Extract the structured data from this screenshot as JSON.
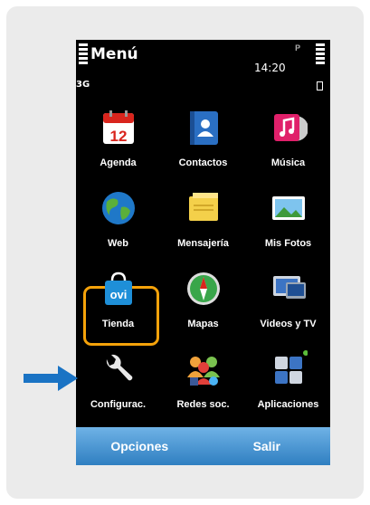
{
  "status": {
    "title": "Menú",
    "network": "3G",
    "time": "14:20"
  },
  "apps": [
    {
      "label": "Agenda",
      "icon": "calendar-icon",
      "badge": "12"
    },
    {
      "label": "Contactos",
      "icon": "contacts-icon"
    },
    {
      "label": "Música",
      "icon": "music-icon"
    },
    {
      "label": "Web",
      "icon": "globe-icon"
    },
    {
      "label": "Mensajería",
      "icon": "envelope-icon"
    },
    {
      "label": "Mis Fotos",
      "icon": "photos-icon"
    },
    {
      "label": "Tienda",
      "icon": "ovi-store-icon",
      "badge": "ovi"
    },
    {
      "label": "Mapas",
      "icon": "compass-icon"
    },
    {
      "label": "Videos y TV",
      "icon": "tv-icon"
    },
    {
      "label": "Configurac.",
      "icon": "wrench-icon",
      "selected": true
    },
    {
      "label": "Redes soc.",
      "icon": "social-networks-icon"
    },
    {
      "label": "Aplicaciones",
      "icon": "apps-folder-icon"
    }
  ],
  "softkeys": {
    "left": "Opciones",
    "right": "Salir"
  },
  "colors": {
    "highlight": "#f5a20a",
    "softkey": "#4a95d1",
    "arrow": "#1a73c4"
  }
}
